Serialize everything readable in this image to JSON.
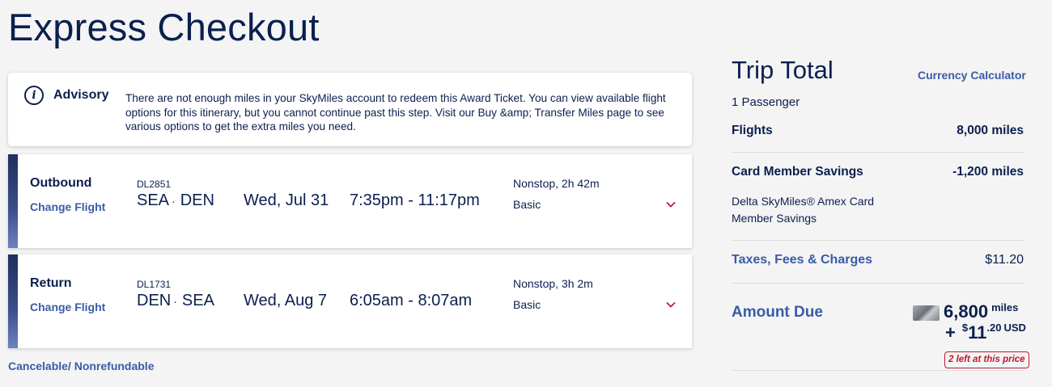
{
  "page": {
    "title": "Express Checkout"
  },
  "advisory": {
    "icon": "info-icon",
    "icon_glyph": "i",
    "title": "Advisory",
    "message": "There are not enough miles in your SkyMiles account to redeem this Award Ticket. You can view available flight options for this itinerary, but you cannot continue past this step. Visit our Buy &amp; Transfer Miles page to see various options to get the extra miles you need."
  },
  "flights": {
    "outbound": {
      "label": "Outbound",
      "change_label": "Change Flight",
      "flight_number": "DL2851",
      "origin": "SEA",
      "destination": "DEN",
      "separator": "·",
      "date": "Wed, Jul 31",
      "times": "7:35pm - 11:17pm",
      "duration": "Nonstop, 2h 42m",
      "fare_class": "Basic"
    },
    "return": {
      "label": "Return",
      "change_label": "Change Flight",
      "flight_number": "DL1731",
      "origin": "DEN",
      "destination": "SEA",
      "separator": "·",
      "date": "Wed, Aug 7",
      "times": "6:05am - 8:07am",
      "duration": "Nonstop, 3h 2m",
      "fare_class": "Basic"
    },
    "policy_note": "Cancelable/ Nonrefundable"
  },
  "trip_total": {
    "title": "Trip Total",
    "currency_link": "Currency Calculator",
    "passengers": "1 Passenger",
    "flights_label": "Flights",
    "flights_value": "8,000 miles",
    "savings_label": "Card Member Savings",
    "savings_value": "-1,200 miles",
    "savings_description": "Delta SkyMiles® Amex Card Member Savings",
    "taxes_label": "Taxes, Fees & Charges",
    "taxes_value": "$11.20",
    "amount_due_label": "Amount Due",
    "due_miles": "6,800",
    "due_miles_unit": "miles",
    "due_plus": "+",
    "due_currency_symbol": "$",
    "due_whole": "11",
    "due_cents": ".20",
    "due_currency": "USD",
    "availability_badge": "2 left at this price"
  },
  "colors": {
    "navy": "#0b1f4f",
    "link_blue": "#3a5ba8",
    "alert_red": "#c01933",
    "background": "#f4f4f4"
  }
}
